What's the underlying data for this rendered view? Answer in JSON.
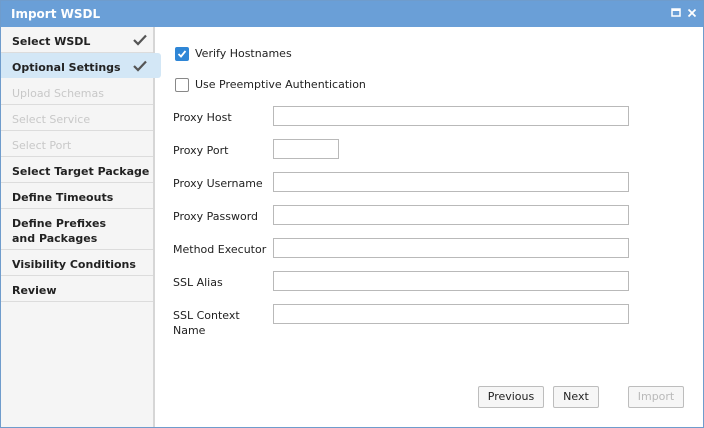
{
  "window": {
    "title": "Import WSDL",
    "maximize_icon": "maximize-icon",
    "close_icon": "close-icon",
    "title_bar_color": "#6a9fd7"
  },
  "sidebar": {
    "items": [
      {
        "label": "Select WSDL",
        "state": "completed"
      },
      {
        "label": "Optional Settings",
        "state": "active-completed"
      },
      {
        "label": "Upload Schemas",
        "state": "disabled"
      },
      {
        "label": "Select Service",
        "state": "disabled"
      },
      {
        "label": "Select Port",
        "state": "disabled"
      },
      {
        "label": "Select Target Package",
        "state": "enabled"
      },
      {
        "label": "Define Timeouts",
        "state": "enabled"
      },
      {
        "label": "Define Prefixes and Packages",
        "state": "enabled"
      },
      {
        "label": "Visibility Conditions",
        "state": "enabled"
      },
      {
        "label": "Review",
        "state": "enabled"
      }
    ],
    "active_color": "#d3e7f6"
  },
  "options": {
    "verify_hostnames": {
      "label": "Verify Hostnames",
      "checked": true
    },
    "preemptive_auth": {
      "label": "Use Preemptive Authentication",
      "checked": false
    }
  },
  "fields": {
    "proxy_host": {
      "label": "Proxy Host",
      "value": ""
    },
    "proxy_port": {
      "label": "Proxy Port",
      "value": ""
    },
    "proxy_username": {
      "label": "Proxy Username",
      "value": ""
    },
    "proxy_password": {
      "label": "Proxy Password",
      "value": ""
    },
    "method_executor": {
      "label": "Method Executor",
      "value": ""
    },
    "ssl_alias": {
      "label": "SSL Alias",
      "value": ""
    },
    "ssl_context_name": {
      "label": "SSL Context Name",
      "value": ""
    }
  },
  "buttons": {
    "previous": "Previous",
    "next": "Next",
    "import": "Import"
  }
}
